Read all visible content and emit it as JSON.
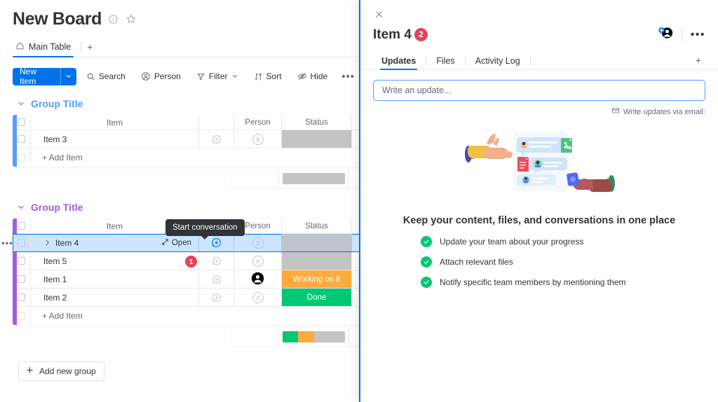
{
  "board": {
    "title": "New Board",
    "icons": {
      "info": "info-icon",
      "star": "star-icon"
    },
    "tabs": [
      {
        "label": "Main Table",
        "icon": "home-icon",
        "active": true
      }
    ],
    "add_tab_label": "+",
    "toolbar": {
      "new_item": "New Item",
      "search": "Search",
      "person": "Person",
      "filter": "Filter",
      "sort": "Sort",
      "hide": "Hide",
      "more": "•••"
    },
    "columns": {
      "item": "Item",
      "person": "Person",
      "status": "Status"
    },
    "groups": [
      {
        "title": "Group Title",
        "color": "#579bfc",
        "rows": [
          {
            "name": "Item 3",
            "person": "",
            "status": "",
            "status_color": "#c4c4c4"
          }
        ],
        "add_item_label": "+ Add Item",
        "summary_segments": [
          {
            "color": "#c4c4c4",
            "pct": 100
          }
        ]
      },
      {
        "title": "Group Title",
        "color": "#a25ddc",
        "rows": [
          {
            "name": "Item 4",
            "person": "",
            "status": "",
            "status_color": "#c4c4c4",
            "selected": true,
            "open_label": "Open"
          },
          {
            "name": "Item 5",
            "person": "",
            "status": "",
            "status_color": "#c4c4c4"
          },
          {
            "name": "Item 1",
            "person": "avatar",
            "status": "Working on it",
            "status_color": "#fdab3d"
          },
          {
            "name": "Item 2",
            "person": "",
            "status": "Done",
            "status_color": "#00c875"
          }
        ],
        "add_item_label": "+ Add Item",
        "summary_segments": [
          {
            "color": "#00c875",
            "pct": 25
          },
          {
            "color": "#fdab3d",
            "pct": 25
          },
          {
            "color": "#c4c4c4",
            "pct": 50
          }
        ]
      }
    ],
    "tooltip": "Start conversation",
    "step_badge_1": "1",
    "add_new_group": "Add new group"
  },
  "panel": {
    "close_icon": "close-icon",
    "title": "Item 4",
    "title_badge": "2",
    "actions": {
      "invite": "add-person-icon",
      "more": "•••"
    },
    "tabs": [
      {
        "label": "Updates",
        "active": true
      },
      {
        "label": "Files",
        "active": false
      },
      {
        "label": "Activity Log",
        "active": false
      }
    ],
    "add_tab_label": "+",
    "update_placeholder": "Write an update...",
    "email_link": "Write updates via email:",
    "empty_state": {
      "title": "Keep your content, files, and conversations in one place",
      "bullets": [
        "Update your team about your progress",
        "Attach relevant files",
        "Notify specific team members by mentioning them"
      ]
    }
  },
  "colors": {
    "primary": "#0073ea",
    "blue_group": "#579bfc",
    "purple_group": "#a25ddc",
    "done": "#00c875",
    "working": "#fdab3d",
    "empty_status": "#c4c4c4",
    "badge_red": "#e2445c"
  }
}
